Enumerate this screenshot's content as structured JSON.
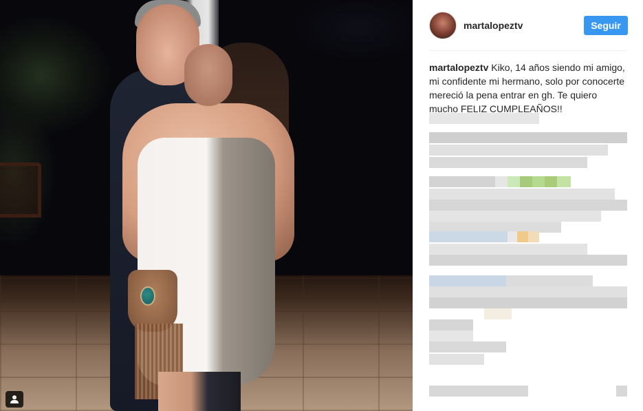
{
  "post": {
    "username": "martalopeztv",
    "follow_label": "Seguir",
    "caption_user": "martalopeztv",
    "caption_text": " Kiko, 14 años siendo mi amigo, mi confidente mi hermano, solo por conocerte mereció la pena entrar en gh. Te quiero mucho FELIZ CUMPLEAÑOS!!"
  },
  "icons": {
    "user_tag": "user-tag-icon"
  },
  "colors": {
    "follow_button": "#3897f0",
    "divider": "#efefef",
    "text": "#262626"
  }
}
